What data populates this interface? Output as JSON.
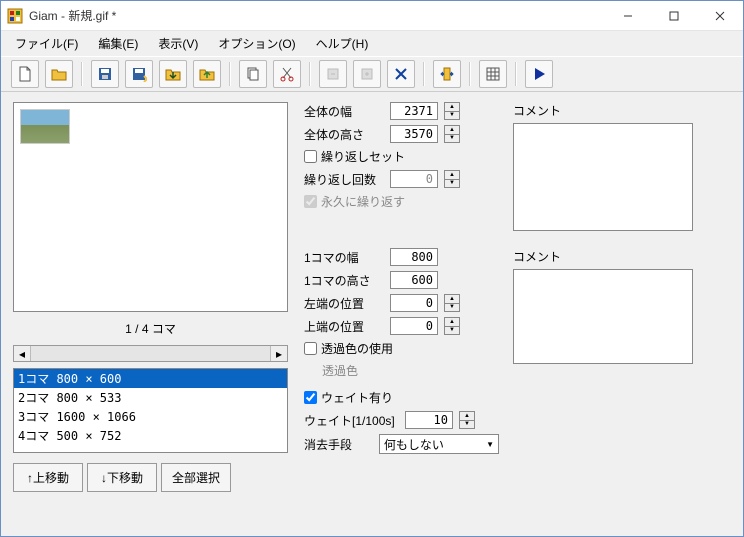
{
  "window": {
    "title": "Giam - 新規.gif *"
  },
  "menu": {
    "file": "ファイル(F)",
    "file_u": "F",
    "edit": "編集(E)",
    "edit_u": "E",
    "view": "表示(V)",
    "view_u": "V",
    "option": "オプション(O)",
    "option_u": "O",
    "help": "ヘルプ(H)",
    "help_u": "H"
  },
  "left": {
    "counter": "1 / 4 コマ",
    "frames": [
      "1コマ 800 × 600",
      "2コマ 800 × 533",
      "3コマ 1600 × 1066",
      "4コマ 500 × 752"
    ],
    "btn_up": "↑上移動",
    "btn_down": "↓下移動",
    "btn_all": "全部選択"
  },
  "global": {
    "width_label": "全体の幅",
    "width_value": "2371",
    "height_label": "全体の高さ",
    "height_value": "3570",
    "repeatset_label": "繰り返しセット",
    "repeatset_checked": false,
    "repeatcount_label": "繰り返し回数",
    "repeatcount_value": "0",
    "forever_label": "永久に繰り返す",
    "forever_checked": true,
    "comment_label": "コメント",
    "comment_value": ""
  },
  "frame": {
    "width_label": "1コマの幅",
    "width_value": "800",
    "height_label": "1コマの高さ",
    "height_value": "600",
    "left_label": "左端の位置",
    "left_value": "0",
    "top_label": "上端の位置",
    "top_value": "0",
    "trans_label": "透過色の使用",
    "trans_checked": false,
    "transcolor_label": "透過色",
    "wait_label": "ウェイト有り",
    "wait_checked": true,
    "waitval_label": "ウェイト[1/100s]",
    "waitval_value": "10",
    "dispose_label": "消去手段",
    "dispose_value": "何もしない",
    "comment_label": "コメント",
    "comment_value": ""
  }
}
